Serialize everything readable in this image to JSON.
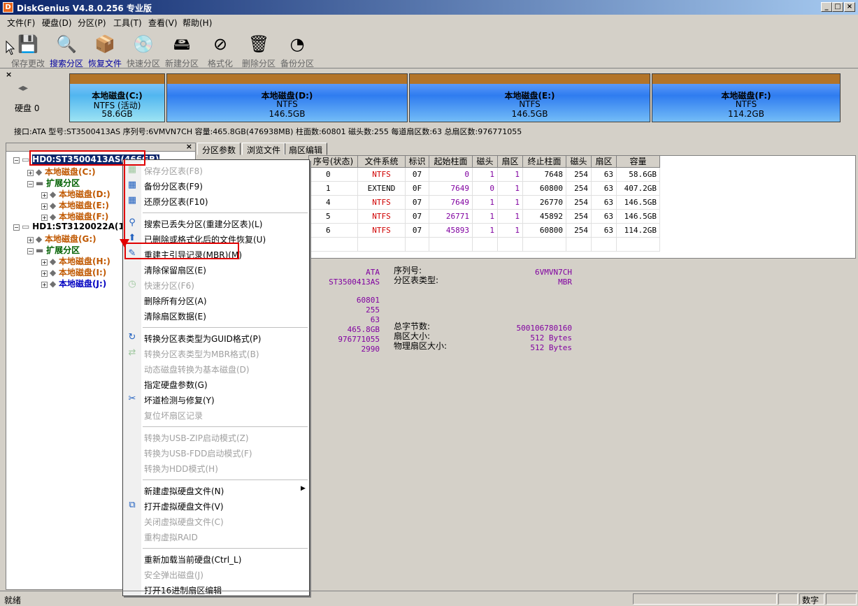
{
  "window": {
    "title": "DiskGenius V4.8.0.256 专业版",
    "app_icon": "D",
    "minimize": "_",
    "maximize": "□",
    "close": "×"
  },
  "menu": [
    "文件(F)",
    "硬盘(D)",
    "分区(P)",
    "工具(T)",
    "查看(V)",
    "帮助(H)"
  ],
  "toolbar": [
    {
      "label": "保存更改",
      "icon": "floppy-icon",
      "glyph": "💾"
    },
    {
      "label": "搜索分区",
      "icon": "magnifier-icon",
      "glyph": "🔍"
    },
    {
      "label": "恢复文件",
      "icon": "recover-icon",
      "glyph": "📦"
    },
    {
      "label": "快速分区",
      "icon": "quick-partition-icon",
      "glyph": "💿"
    },
    {
      "label": "新建分区",
      "icon": "new-partition-icon",
      "glyph": "🖴"
    },
    {
      "label": "格式化",
      "icon": "format-icon",
      "glyph": "⊘"
    },
    {
      "label": "删除分区",
      "icon": "trash-icon",
      "glyph": "🗑"
    },
    {
      "label": "备份分区",
      "icon": "backup-icon",
      "glyph": "◔"
    }
  ],
  "diskbar": {
    "close": "×",
    "disk_label": "硬盘 0",
    "partitions": [
      {
        "name": "本地磁盘(C:)",
        "fs": "NTFS (活动)",
        "size": "58.6GB"
      },
      {
        "name": "本地磁盘(D:)",
        "fs": "NTFS",
        "size": "146.5GB"
      },
      {
        "name": "本地磁盘(E:)",
        "fs": "NTFS",
        "size": "146.5GB"
      },
      {
        "name": "本地磁盘(F:)",
        "fs": "NTFS",
        "size": "114.2GB"
      }
    ],
    "info": "接口:ATA  型号:ST3500413AS  序列号:6VMVN7CH  容量:465.8GB(476938MB)  柱面数:60801  磁头数:255  每道扇区数:63  总扇区数:976771055"
  },
  "tree": [
    {
      "text": "HD0:ST3500413AS(466GB)",
      "cls": "selected",
      "indent": 0,
      "exp": "−"
    },
    {
      "text": "本地磁盘(C:)",
      "cls": "brown",
      "indent": 1,
      "exp": "+"
    },
    {
      "text": "扩展分区",
      "cls": "green",
      "indent": 1,
      "exp": "−"
    },
    {
      "text": "本地磁盘(D:)",
      "cls": "brown",
      "indent": 2,
      "exp": "+"
    },
    {
      "text": "本地磁盘(E:)",
      "cls": "brown",
      "indent": 2,
      "exp": "+"
    },
    {
      "text": "本地磁盘(F:)",
      "cls": "brown",
      "indent": 2,
      "exp": "+"
    },
    {
      "text": "HD1:ST3120022A(112GB)",
      "cls": "",
      "indent": 0,
      "exp": "−"
    },
    {
      "text": "本地磁盘(G:)",
      "cls": "brown",
      "indent": 1,
      "exp": "+"
    },
    {
      "text": "扩展分区",
      "cls": "green",
      "indent": 1,
      "exp": "−"
    },
    {
      "text": "本地磁盘(H:)",
      "cls": "brown",
      "indent": 2,
      "exp": "+"
    },
    {
      "text": "本地磁盘(I:)",
      "cls": "brown",
      "indent": 2,
      "exp": "+"
    },
    {
      "text": "本地磁盘(J:)",
      "cls": "blueb",
      "indent": 2,
      "exp": "+"
    }
  ],
  "tabs": [
    "分区参数",
    "浏览文件",
    "扇区编辑"
  ],
  "table": {
    "headers": [
      "序号(状态)",
      "文件系统",
      "标识",
      "起始柱面",
      "磁头",
      "扇区",
      "终止柱面",
      "磁头",
      "扇区",
      "容量"
    ],
    "rows": [
      [
        "0",
        "NTFS",
        "07",
        "0",
        "1",
        "1",
        "7648",
        "254",
        "63",
        "58.6GB"
      ],
      [
        "1",
        "EXTEND",
        "0F",
        "7649",
        "0",
        "1",
        "60800",
        "254",
        "63",
        "407.2GB"
      ],
      [
        "4",
        "NTFS",
        "07",
        "7649",
        "1",
        "1",
        "26770",
        "254",
        "63",
        "146.5GB"
      ],
      [
        "5",
        "NTFS",
        "07",
        "26771",
        "1",
        "1",
        "45892",
        "254",
        "63",
        "146.5GB"
      ],
      [
        "6",
        "NTFS",
        "07",
        "45893",
        "1",
        "1",
        "60800",
        "254",
        "63",
        "114.2GB"
      ]
    ]
  },
  "details": {
    "left_values": [
      "ATA",
      "ST3500413AS",
      "60801",
      "255",
      "63",
      "465.8GB",
      "976771055",
      "2990"
    ],
    "right_labels": [
      "序列号:",
      "分区表类型:",
      "总字节数:",
      "扇区大小:",
      "物理扇区大小:"
    ],
    "right_values": [
      "6VMVN7CH",
      "MBR",
      "500106780160",
      "512 Bytes",
      "512 Bytes"
    ]
  },
  "context_menu": [
    {
      "label": "保存分区表(F8)",
      "disabled": true,
      "icon": "save-table-icon",
      "glyph": "▦"
    },
    {
      "label": "备份分区表(F9)",
      "disabled": false,
      "icon": "backup-table-icon",
      "glyph": "▦"
    },
    {
      "label": "还原分区表(F10)",
      "disabled": false,
      "icon": "restore-table-icon",
      "glyph": "▦"
    },
    {
      "sep": true
    },
    {
      "label": "搜索已丢失分区(重建分区表)(L)",
      "disabled": false,
      "icon": "search-lost-icon",
      "glyph": "⚲"
    },
    {
      "label": "已删除或格式化后的文件恢复(U)",
      "disabled": false,
      "icon": "file-recover-icon",
      "glyph": "⬆"
    },
    {
      "label": "重建主引导记录(MBR)(M)",
      "disabled": false,
      "icon": "rebuild-mbr-icon",
      "glyph": "✎"
    },
    {
      "label": "清除保留扇区(E)",
      "disabled": false,
      "icon": "",
      "glyph": ""
    },
    {
      "label": "快速分区(F6)",
      "disabled": true,
      "icon": "quick-partition-icon",
      "glyph": "◷"
    },
    {
      "label": "删除所有分区(A)",
      "disabled": false,
      "icon": "",
      "glyph": ""
    },
    {
      "label": "清除扇区数据(E)",
      "disabled": false,
      "icon": "",
      "glyph": ""
    },
    {
      "sep": true
    },
    {
      "label": "转换分区表类型为GUID格式(P)",
      "disabled": false,
      "icon": "convert-guid-icon",
      "glyph": "↻"
    },
    {
      "label": "转换分区表类型为MBR格式(B)",
      "disabled": true,
      "icon": "convert-mbr-icon",
      "glyph": "⇄"
    },
    {
      "label": "动态磁盘转换为基本磁盘(D)",
      "disabled": true,
      "icon": "",
      "glyph": ""
    },
    {
      "label": "指定硬盘参数(G)",
      "disabled": false,
      "icon": "",
      "glyph": ""
    },
    {
      "label": "坏道检测与修复(Y)",
      "disabled": false,
      "icon": "repair-tools-icon",
      "glyph": "✂"
    },
    {
      "label": "复位坏扇区记录",
      "disabled": true,
      "icon": "",
      "glyph": ""
    },
    {
      "sep": true
    },
    {
      "label": "转换为USB-ZIP启动模式(Z)",
      "disabled": true,
      "icon": "",
      "glyph": ""
    },
    {
      "label": "转换为USB-FDD启动模式(F)",
      "disabled": true,
      "icon": "",
      "glyph": ""
    },
    {
      "label": "转换为HDD模式(H)",
      "disabled": true,
      "icon": "",
      "glyph": ""
    },
    {
      "sep": true
    },
    {
      "label": "新建虚拟硬盘文件(N)",
      "disabled": false,
      "icon": "",
      "glyph": "",
      "submenu": true
    },
    {
      "label": "打开虚拟硬盘文件(V)",
      "disabled": false,
      "icon": "open-vdisk-icon",
      "glyph": "⧉"
    },
    {
      "label": "关闭虚拟硬盘文件(C)",
      "disabled": true,
      "icon": "",
      "glyph": ""
    },
    {
      "label": "重构虚拟RAID",
      "disabled": true,
      "icon": "",
      "glyph": ""
    },
    {
      "sep": true
    },
    {
      "label": "重新加载当前硬盘(Ctrl_L)",
      "disabled": false,
      "icon": "",
      "glyph": ""
    },
    {
      "label": "安全弹出磁盘(J)",
      "disabled": true,
      "icon": "",
      "glyph": ""
    },
    {
      "label": "打开16进制扇区编辑",
      "disabled": false,
      "icon": "",
      "glyph": ""
    }
  ],
  "statusbar": {
    "status": "就绪",
    "mode": "数字"
  }
}
